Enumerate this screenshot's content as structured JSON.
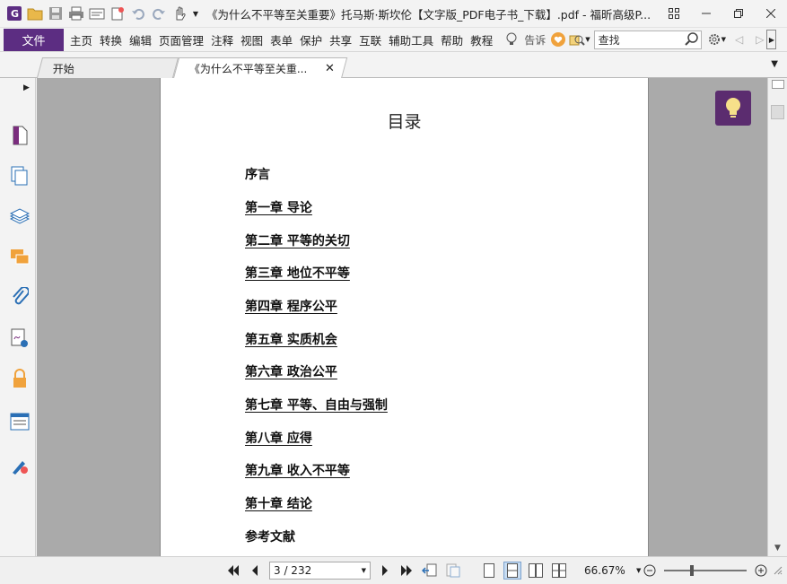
{
  "window": {
    "title": "《为什么不平等至关重要》托马斯·斯坎伦【文字版_PDF电子书_下载】.pdf - 福昕高级P..."
  },
  "menubar": {
    "file_label": "文件",
    "items": [
      "主页",
      "转换",
      "编辑",
      "页面管理",
      "注释",
      "视图",
      "表单",
      "保护",
      "共享",
      "互联",
      "辅助工具",
      "帮助",
      "教程"
    ],
    "tell_label": "告诉",
    "search_placeholder": "查找"
  },
  "tabs": {
    "start_label": "开始",
    "doc_label": "《为什么不平等至关重..."
  },
  "document": {
    "toc_title": "目录",
    "toc_items": [
      "序言",
      "第一章 导论",
      "第二章 平等的关切",
      "第三章 地位不平等",
      "第四章 程序公平",
      "第五章 实质机会",
      "第六章 政治公平",
      "第七章 平等、自由与强制",
      "第八章 应得",
      "第九章 收入不平等",
      "第十章 结论",
      "参考文献"
    ]
  },
  "statusbar": {
    "page_display": "3 / 232",
    "zoom": "66.67%",
    "zoom_fraction": 0.33
  },
  "colors": {
    "brand": "#5c2d82",
    "bulb_bg": "#5b2c6f",
    "viewer_bg": "#aaaaaa"
  }
}
